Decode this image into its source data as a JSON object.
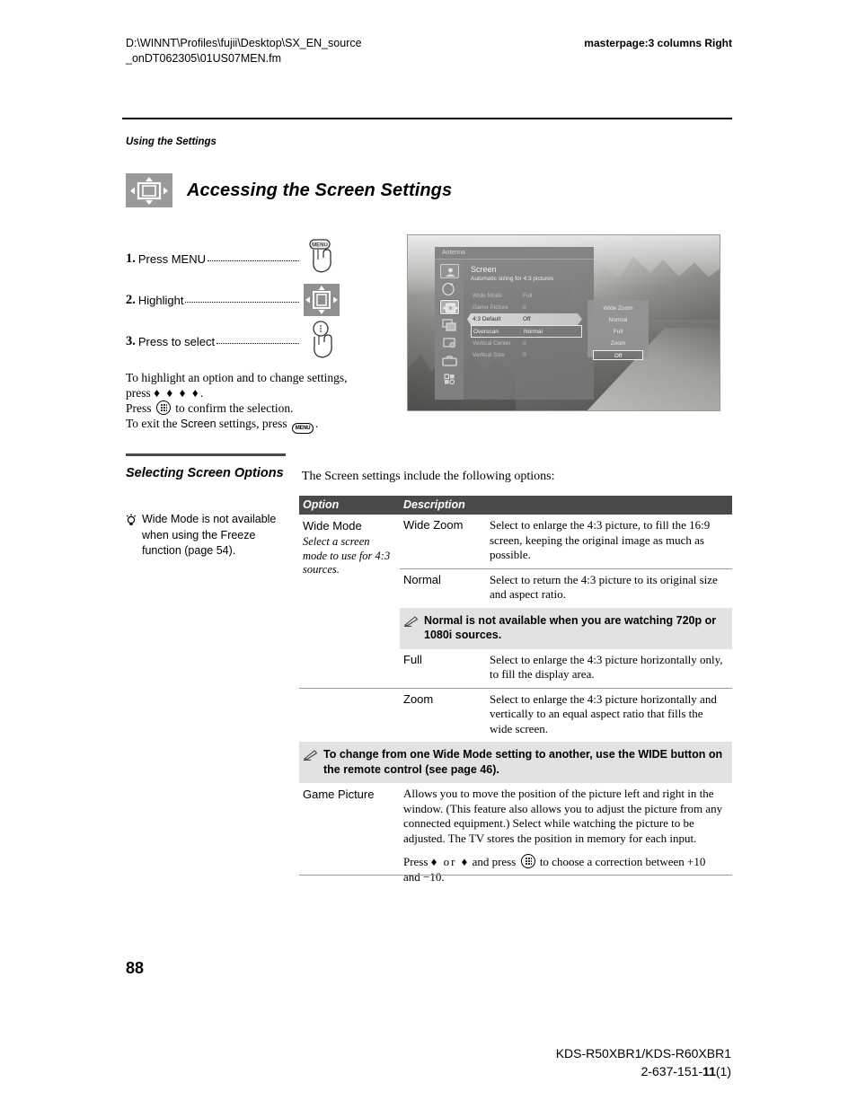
{
  "header": {
    "path_line1": "D:\\WINNT\\Profiles\\fujii\\Desktop\\SX_EN_source",
    "path_line2": "_onDT062305\\01US07MEN.fm",
    "masterpage": "masterpage:3 columns Right"
  },
  "running_head": "Using the Settings",
  "title": "Accessing the Screen Settings",
  "title_icon": "screen-size-icon",
  "steps": [
    {
      "num": "1.",
      "label": "Press MENU",
      "icon": "hand-pressing-menu-button-icon"
    },
    {
      "num": "2.",
      "label": "Highlight",
      "icon": "four-way-navigation-pad-icon"
    },
    {
      "num": "3.",
      "label": "Press to select",
      "icon": "hand-pressing-enter-button-icon"
    }
  ],
  "instructions": {
    "line1": "To highlight an option and to change settings,",
    "line2_pre": "press",
    "line2_arrows": "♦ ♦ ♦ ♦",
    "line2_post": ".",
    "line3_pre": "Press",
    "line3_post": "to confirm the selection.",
    "line4_pre": "To exit the",
    "line4_screen": "Screen",
    "line4_mid": "settings, press",
    "line4_post": ".",
    "enter_button_label": "enter-button-icon",
    "menu_button_label": "MENU"
  },
  "tv_screenshot": {
    "name": "tv-on-screen-display-photo",
    "tab_label": "Antenna",
    "menu_title": "Screen",
    "menu_subtitle": "Automatic sizing for 4:3 pictures",
    "rail_icons": [
      "picture-settings-icon",
      "audio-settings-icon",
      "screen-settings-icon",
      "channel-settings-icon",
      "parental-lock-icon",
      "setup-toolbox-icon",
      "apps-grid-icon"
    ],
    "rows": [
      {
        "label": "Wide Mode",
        "value": "Full",
        "state": "dim"
      },
      {
        "label": "Game Picture",
        "value": "0",
        "state": "dim"
      },
      {
        "label": "4:3 Default",
        "value": "Off",
        "state": "highlight-arrow"
      },
      {
        "label": "Overscan",
        "value": "Normal",
        "state": "highlight-box"
      },
      {
        "label": "Vertical Center",
        "value": "0",
        "state": "dim"
      },
      {
        "label": "Vertical Size",
        "value": "0",
        "state": "dim"
      }
    ],
    "popup_options": [
      "Wide Zoom",
      "Normal",
      "Full",
      "Zoom",
      "Off"
    ],
    "popup_selected": "Off"
  },
  "sidebar": {
    "heading": "Selecting Screen Options",
    "tip_icon": "lightbulb-tip-icon",
    "tip_text": "Wide Mode is not available when using the Freeze function (page 54)."
  },
  "intro": "The Screen settings include the following options:",
  "table": {
    "headers": {
      "option": "Option",
      "description": "Description"
    },
    "rows": [
      {
        "kind": "option",
        "option": "Wide Mode",
        "option_sub": "Select a screen mode to use for 4:3 sources.",
        "value": "Wide Zoom",
        "description": "Select to enlarge the 4:3 picture, to fill the 16:9 screen, keeping the original image as much as possible."
      },
      {
        "kind": "value",
        "value": "Normal",
        "description": "Select to return the 4:3 picture to its original size and aspect ratio."
      },
      {
        "kind": "note",
        "icon": "note-pencil-icon",
        "text": "Normal is not available when you are watching 720p or 1080i sources."
      },
      {
        "kind": "value",
        "value": "Full",
        "description": "Select to enlarge the 4:3 picture horizontally only, to fill the display area."
      },
      {
        "kind": "value",
        "value": "Zoom",
        "description": "Select to enlarge the 4:3 picture horizontally and vertically to an equal aspect ratio that fills the wide screen."
      },
      {
        "kind": "note-wide",
        "icon": "note-pencil-icon",
        "text": "To change from one Wide Mode setting to another, use the WIDE button on the remote control (see page 46)."
      },
      {
        "kind": "option-wide",
        "option": "Game Picture",
        "description": "Allows you to move the position of the picture left and right in the window. (This feature also allows you to adjust the picture from any connected equipment.) Select while watching the picture to be adjusted. The TV stores the position in memory for each input.",
        "description2_pre": "Press",
        "description2_arrows": "♦ or ♦",
        "description2_mid": "and press",
        "description2_post": "to choose a correction between +10 and −10."
      }
    ]
  },
  "footer": {
    "page_number": "88",
    "model": "KDS-R50XBR1/KDS-R60XBR1",
    "doc_pre": "2-637-151-",
    "doc_bold": "11",
    "doc_post": "(1)"
  }
}
